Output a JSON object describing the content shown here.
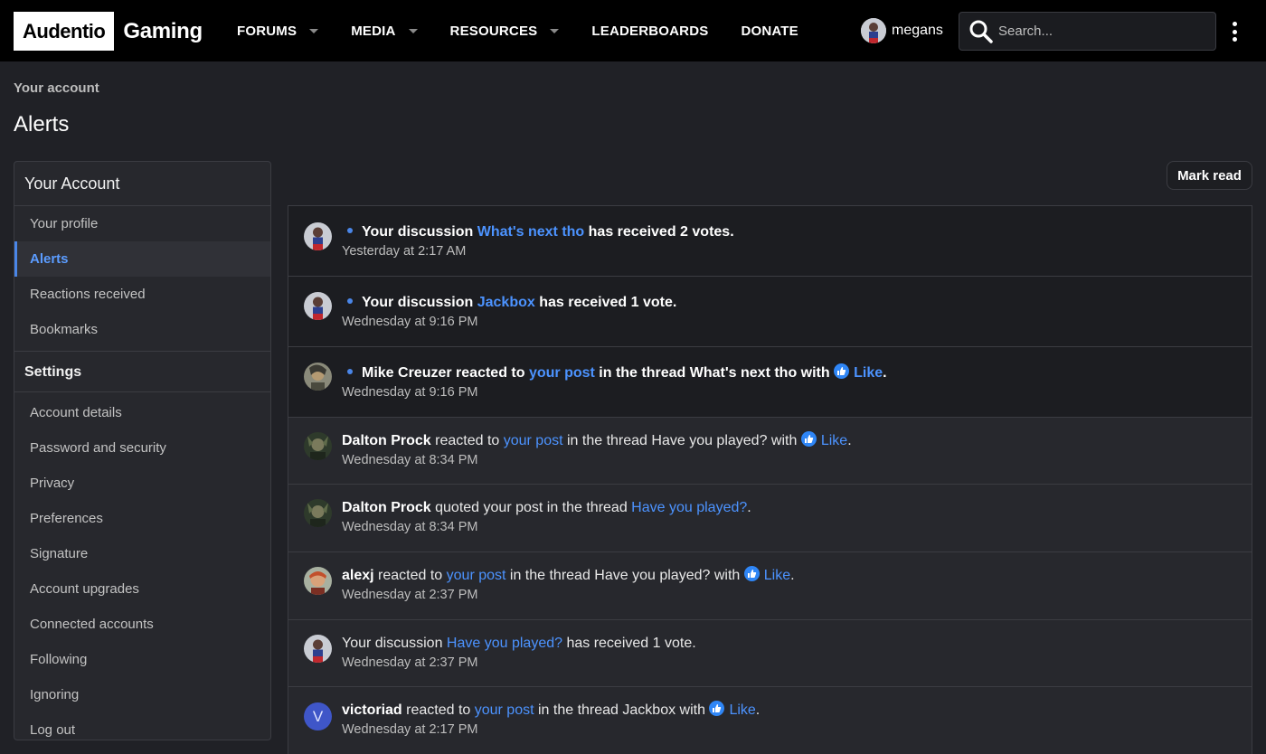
{
  "header": {
    "logo_box": "Audentio",
    "logo_text": "Gaming",
    "nav": [
      {
        "label": "FORUMS"
      },
      {
        "label": "MEDIA"
      },
      {
        "label": "RESOURCES"
      },
      {
        "label": "LEADERBOARDS"
      },
      {
        "label": "DONATE"
      }
    ],
    "username": "megans",
    "search_placeholder": "Search..."
  },
  "page": {
    "breadcrumb": "Your account",
    "title": "Alerts",
    "mark_read": "Mark read"
  },
  "sidebar": {
    "heading": "Your Account",
    "account_items": [
      {
        "label": "Your profile"
      },
      {
        "label": "Alerts"
      },
      {
        "label": "Reactions received"
      },
      {
        "label": "Bookmarks"
      }
    ],
    "settings_heading": "Settings",
    "settings_items": [
      {
        "label": "Account details"
      },
      {
        "label": "Password and security"
      },
      {
        "label": "Privacy"
      },
      {
        "label": "Preferences"
      },
      {
        "label": "Signature"
      },
      {
        "label": "Account upgrades"
      },
      {
        "label": "Connected accounts"
      },
      {
        "label": "Following"
      },
      {
        "label": "Ignoring"
      },
      {
        "label": "Log out"
      }
    ]
  },
  "alerts": [
    {
      "t1": "Your discussion ",
      "link": "What's next tho",
      "t2": " has received 2 votes.",
      "time": "Yesterday at 2:17 AM"
    },
    {
      "t1": "Your discussion ",
      "link": "Jackbox",
      "t2": " has received 1 vote.",
      "time": "Wednesday at 9:16 PM"
    },
    {
      "user": "Mike Creuzer",
      "t1": " reacted to ",
      "link": "your post",
      "t2": " in the thread What's next tho with ",
      "reaction": "Like",
      "end": ".",
      "time": "Wednesday at 9:16 PM"
    },
    {
      "user": "Dalton Prock",
      "t1": " reacted to ",
      "link": "your post",
      "t2": " in the thread Have you played? with ",
      "reaction": "Like",
      "end": ".",
      "time": "Wednesday at 8:34 PM"
    },
    {
      "user": "Dalton Prock",
      "t1": " quoted your post in the thread ",
      "link": "Have you played?",
      "t2": ".",
      "time": "Wednesday at 8:34 PM"
    },
    {
      "user": "alexj",
      "t1": " reacted to ",
      "link": "your post",
      "t2": " in the thread Have you played? with ",
      "reaction": "Like",
      "end": ".",
      "time": "Wednesday at 2:37 PM"
    },
    {
      "t1": "Your discussion ",
      "link": "Have you played?",
      "t2": " has received 1 vote.",
      "time": "Wednesday at 2:37 PM"
    },
    {
      "user": "victoriad",
      "avatar_letter": "V",
      "t1": " reacted to ",
      "link": "your post",
      "t2": " in the thread Jackbox with ",
      "reaction": "Like",
      "end": ".",
      "time": "Wednesday at 2:17 PM"
    }
  ],
  "colors": {
    "accent": "#4c93ff",
    "reaction_blue": "#2f86f6",
    "background": "#202126",
    "unread_row": "#1c1d21"
  }
}
